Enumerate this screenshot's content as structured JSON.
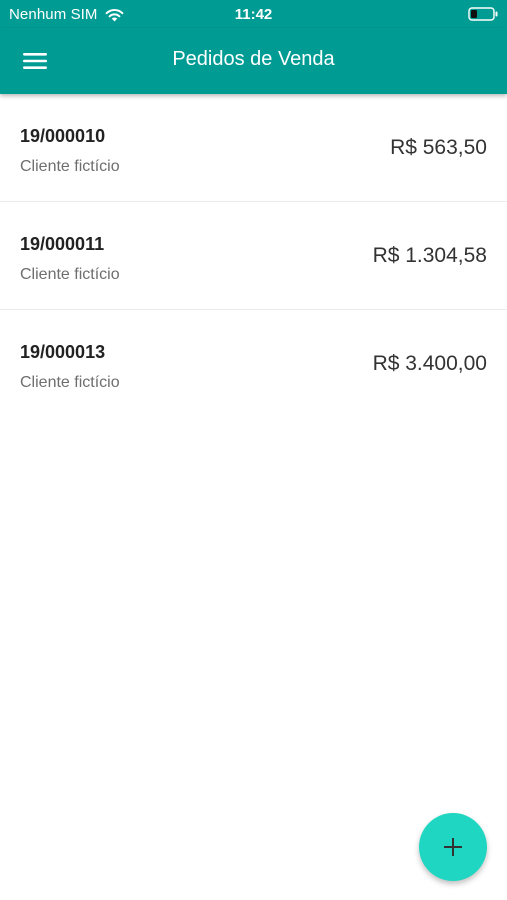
{
  "status_bar": {
    "carrier": "Nenhum SIM",
    "time": "11:42",
    "wifi_icon": "wifi-icon",
    "battery_icon": "battery-low-icon"
  },
  "app_bar": {
    "title": "Pedidos de Venda",
    "menu_icon": "hamburger-menu-icon"
  },
  "orders": [
    {
      "number": "19/000010",
      "client": "Cliente fictício",
      "total": "R$ 563,50"
    },
    {
      "number": "19/000011",
      "client": "Cliente fictício",
      "total": "R$ 1.304,58"
    },
    {
      "number": "19/000013",
      "client": "Cliente fictício",
      "total": "R$ 3.400,00"
    }
  ],
  "fab": {
    "icon": "plus-icon"
  },
  "colors": {
    "primary": "#009c94",
    "accent": "#1ed6c1"
  }
}
